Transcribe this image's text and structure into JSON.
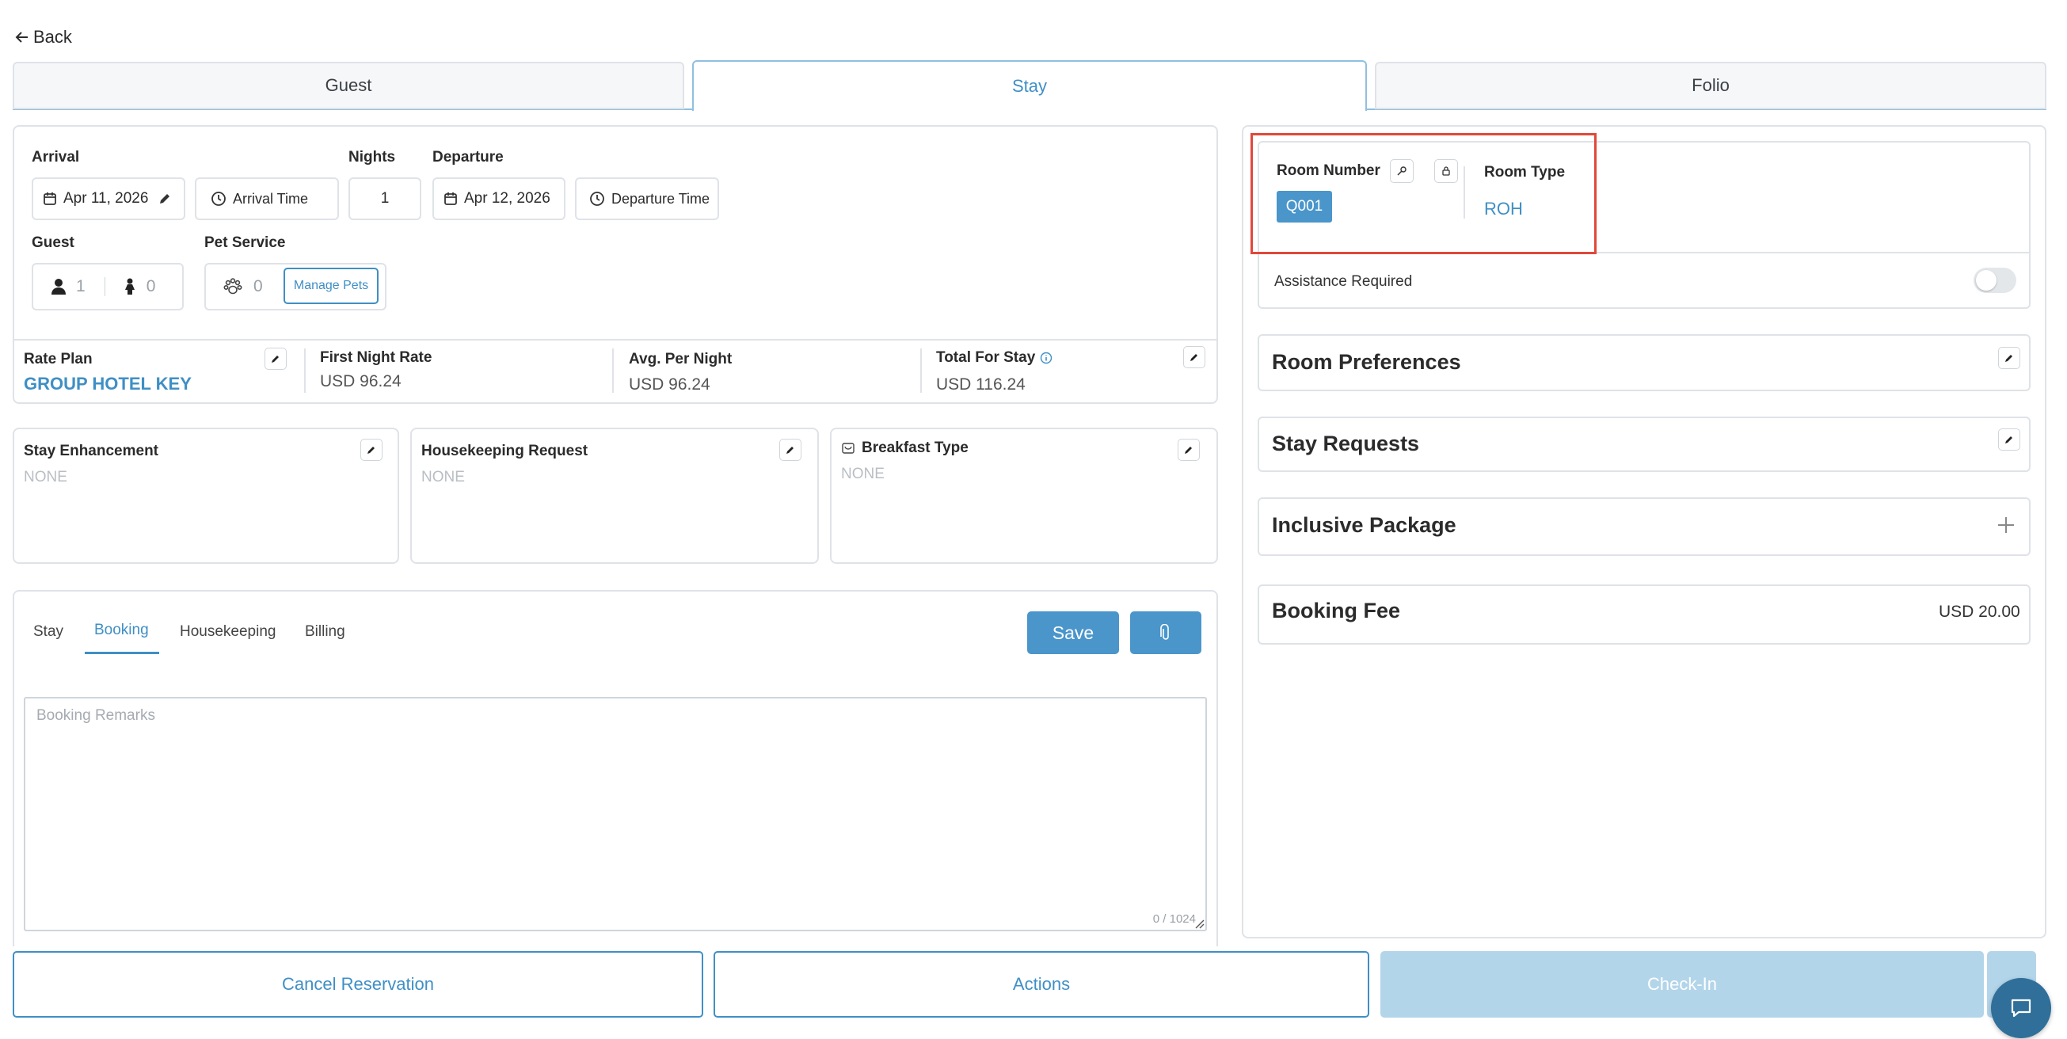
{
  "nav": {
    "back_label": "Back"
  },
  "tabs": [
    {
      "label": "Guest"
    },
    {
      "label": "Stay"
    },
    {
      "label": "Folio"
    }
  ],
  "stay": {
    "arrival_label": "Arrival",
    "arrival_date": "Apr 11, 2026",
    "arrival_time_label": "Arrival Time",
    "nights_label": "Nights",
    "nights_value": "1",
    "departure_label": "Departure",
    "departure_date": "Apr 12, 2026",
    "departure_time_label": "Departure Time",
    "guest_label": "Guest",
    "adults": "1",
    "children": "0",
    "pet_label": "Pet Service",
    "pets": "0",
    "manage_pets_label": "Manage Pets"
  },
  "rates": {
    "rate_plan_label": "Rate Plan",
    "rate_plan_value": "GROUP HOTEL KEY",
    "first_night_label": "First Night Rate",
    "first_night_value": "USD 96.24",
    "avg_label": "Avg. Per Night",
    "avg_value": "USD 96.24",
    "total_label": "Total For Stay",
    "total_value": "USD 116.24"
  },
  "requests": {
    "enhancement_label": "Stay Enhancement",
    "enhancement_value": "NONE",
    "housekeeping_label": "Housekeeping Request",
    "housekeeping_value": "NONE",
    "breakfast_label": "Breakfast Type",
    "breakfast_value": "NONE"
  },
  "remarks": {
    "tabs": [
      "Stay",
      "Booking",
      "Housekeeping",
      "Billing"
    ],
    "active_tab": "Booking",
    "save_label": "Save",
    "placeholder": "Booking Remarks",
    "counter": "0 / 1024"
  },
  "room": {
    "number_label": "Room Number",
    "number_value": "Q001",
    "type_label": "Room Type",
    "type_value": "ROH",
    "assistance_label": "Assistance Required",
    "assistance_on": false
  },
  "sections": {
    "preferences": "Room Preferences",
    "requests": "Stay Requests",
    "package": "Inclusive Package",
    "booking_fee_label": "Booking Fee",
    "booking_fee_value": "USD 20.00"
  },
  "footer": {
    "cancel_label": "Cancel Reservation",
    "actions_label": "Actions",
    "checkin_label": "Check-In"
  },
  "colors": {
    "accent": "#3f8fc5",
    "highlight_box": "#e0483a",
    "checkin_disabled": "#b3d5ea"
  }
}
